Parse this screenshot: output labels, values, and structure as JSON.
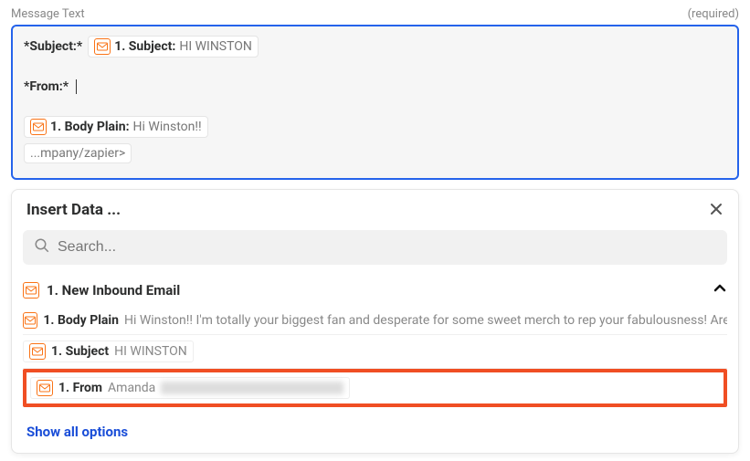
{
  "field": {
    "label": "Message Text",
    "required": "(required)"
  },
  "editor": {
    "subject_prefix": "*Subject:*",
    "subject_token_label": "1. Subject:",
    "subject_token_value": "HI WINSTON",
    "from_prefix": "*From:*",
    "body_token_label": "1. Body Plain:",
    "body_token_value": "Hi Winston!!",
    "truncated_token": "...mpany/zapier>"
  },
  "panel": {
    "title": "Insert Data ...",
    "search_placeholder": "Search...",
    "group_title": "1. New Inbound Email",
    "options": {
      "body": {
        "label": "1. Body Plain",
        "value": "Hi Winston!! I'm totally your biggest fan and desperate for some sweet merch to rep your fabulousness! Are there any p"
      },
      "subject": {
        "label": "1. Subject",
        "value": "HI WINSTON"
      },
      "from": {
        "label": "1. From",
        "value": "Amanda"
      }
    },
    "show_all": "Show all options"
  }
}
